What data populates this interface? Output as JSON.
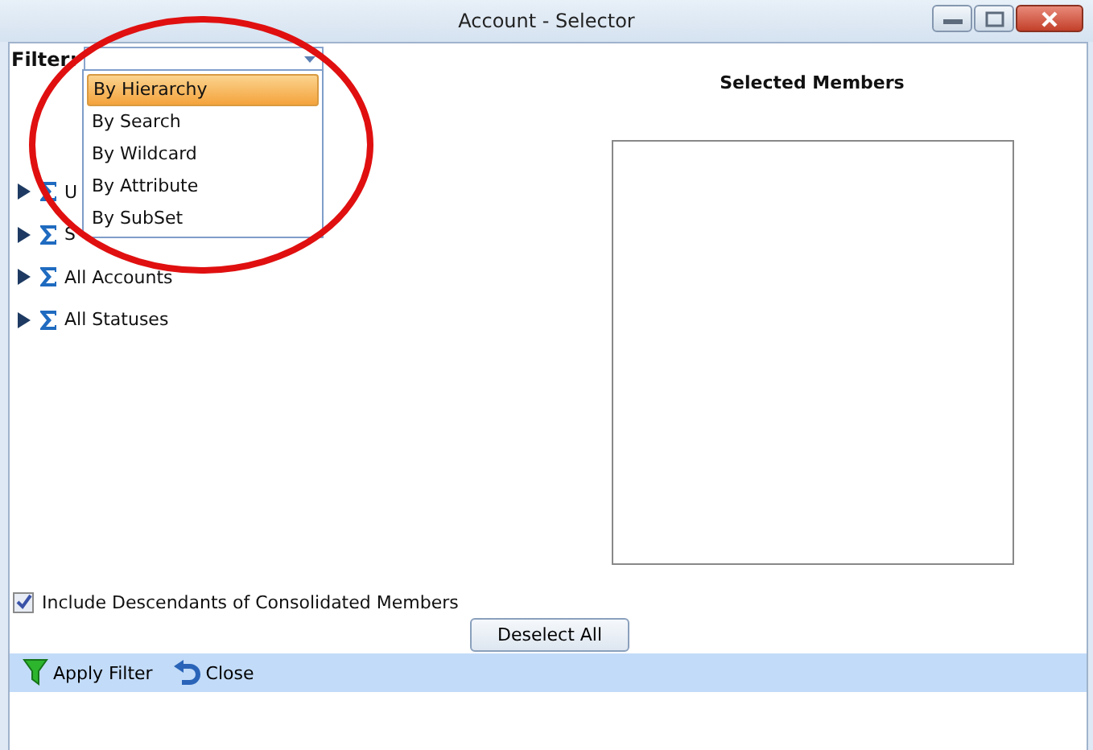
{
  "window": {
    "title": "Account - Selector"
  },
  "filter": {
    "label": "Filter:",
    "options": [
      {
        "label": "By Hierarchy",
        "selected": true
      },
      {
        "label": "By Search",
        "selected": false
      },
      {
        "label": "By Wildcard",
        "selected": false
      },
      {
        "label": "By Attribute",
        "selected": false
      },
      {
        "label": "By SubSet",
        "selected": false
      }
    ]
  },
  "tree": [
    {
      "label": "U"
    },
    {
      "label": "S"
    },
    {
      "label": "All Accounts"
    },
    {
      "label": "All Statuses"
    }
  ],
  "selected_members": {
    "title": "Selected Members"
  },
  "include_descendants": {
    "label": "Include Descendants of Consolidated Members",
    "checked": true
  },
  "deselect_button": "Deselect All",
  "toolbar": [
    {
      "kind": "filter",
      "label": "Apply Filter"
    },
    {
      "kind": "undo",
      "label": "Close"
    }
  ]
}
